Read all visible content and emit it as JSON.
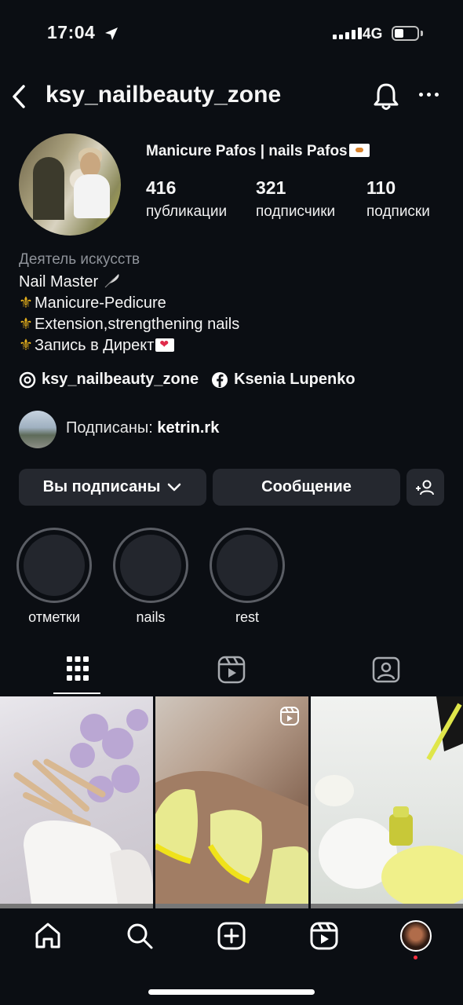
{
  "status": {
    "time": "17:04",
    "network": "4G",
    "battery_level": 0.3
  },
  "header": {
    "username": "ksy_nailbeauty_zone"
  },
  "profile": {
    "display_name": "Manicure Pafos | nails Pafos",
    "stats": [
      {
        "value": "416",
        "label": "публикации"
      },
      {
        "value": "321",
        "label": "подписчики"
      },
      {
        "value": "110",
        "label": "подписки"
      }
    ],
    "category": "Деятель искусств",
    "bio": {
      "line1": "Nail Master",
      "line2": "Manicure-Pedicure",
      "line3": "Extension,strengthening nails",
      "line4": "Запись в Директ"
    },
    "threads_handle": "ksy_nailbeauty_zone",
    "facebook_name": "Ksenia Lupenko",
    "followed_by_prefix": "Подписаны: ",
    "followed_by_user": "ketrin.rk"
  },
  "actions": {
    "following": "Вы подписаны",
    "message": "Сообщение"
  },
  "highlights": [
    {
      "label": "отметки"
    },
    {
      "label": "nails"
    },
    {
      "label": "rest"
    }
  ],
  "tabs": {
    "active": "grid"
  },
  "colors": {
    "background": "#0b0e13",
    "button": "#25282f",
    "notification_dot": "#ff3040"
  }
}
